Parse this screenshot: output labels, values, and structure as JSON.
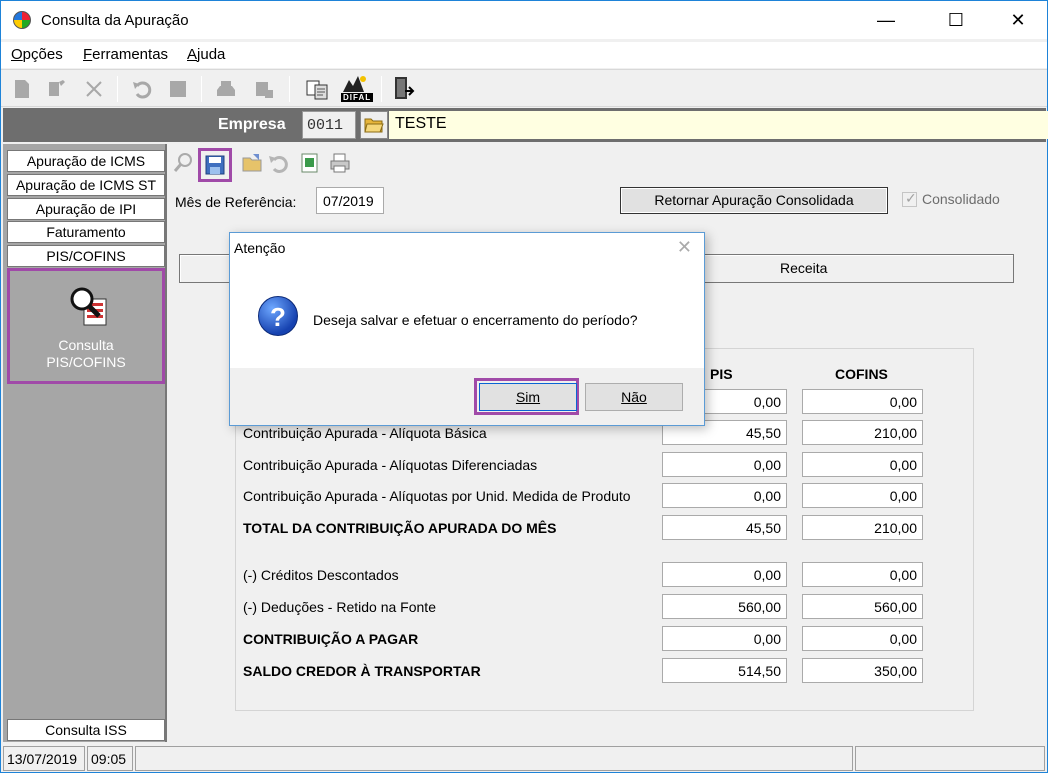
{
  "window": {
    "title": "Consulta da Apuração",
    "controls": {
      "minimize": "—",
      "maximize": "☐",
      "close": "✕"
    }
  },
  "menu": {
    "items": [
      {
        "label": "Opções",
        "underline": "O",
        "rest": "pções"
      },
      {
        "label": "Ferramentas",
        "underline": "F",
        "rest": "erramentas"
      },
      {
        "label": "Ajuda",
        "underline": "A",
        "rest": "juda"
      }
    ]
  },
  "toolbar": {
    "icons": [
      "new-icon",
      "edit-icon",
      "delete-icon",
      "undo-icon",
      "stop-icon",
      "print-icon",
      "print-preview-icon",
      "report-icon",
      "difal-icon",
      "exit-icon"
    ],
    "difal_label": "DIFAL"
  },
  "empresa": {
    "label": "Empresa",
    "code": "0011",
    "name": "TESTE"
  },
  "sidebar": {
    "tabs": [
      "Apuração de ICMS",
      "Apuração de ICMS ST",
      "Apuração de IPI",
      "Faturamento",
      "PIS/COFINS"
    ],
    "panel_label_line1": "Consulta",
    "panel_label_line2": "PIS/COFINS",
    "bottom_tab": "Consulta ISS"
  },
  "content": {
    "mes_label": "Mês de Referência:",
    "mes_value": "07/2019",
    "retornar_button": "Retornar Apuração Consolidada",
    "consolidado_label": "Consolidado",
    "consolidado_checked": true,
    "section_label": "Receita"
  },
  "table": {
    "col_pis": "PIS",
    "col_cofins": "COFINS",
    "rows": [
      {
        "label": "",
        "pis": "0,00",
        "cofins": "0,00",
        "bold": false
      },
      {
        "label": "Contribuição Apurada - Alíquota Básica",
        "pis": "45,50",
        "cofins": "210,00",
        "bold": false
      },
      {
        "label": "Contribuição Apurada - Alíquotas Diferenciadas",
        "pis": "0,00",
        "cofins": "0,00",
        "bold": false
      },
      {
        "label": "Contribuição Apurada - Alíquotas por Unid. Medida de Produto",
        "pis": "0,00",
        "cofins": "0,00",
        "bold": false
      },
      {
        "label": "TOTAL DA CONTRIBUIÇÃO APURADA DO MÊS",
        "pis": "45,50",
        "cofins": "210,00",
        "bold": true
      },
      {
        "label": "(-) Créditos Descontados",
        "pis": "0,00",
        "cofins": "0,00",
        "bold": false
      },
      {
        "label": "(-) Deduções - Retido na Fonte",
        "pis": "560,00",
        "cofins": "560,00",
        "bold": false
      },
      {
        "label": "CONTRIBUIÇÃO A PAGAR",
        "pis": "0,00",
        "cofins": "0,00",
        "bold": true
      },
      {
        "label": "SALDO CREDOR À TRANSPORTAR",
        "pis": "514,50",
        "cofins": "350,00",
        "bold": true
      }
    ]
  },
  "dialog": {
    "title": "Atenção",
    "message": "Deseja salvar e efetuar o encerramento do período?",
    "yes_button": "Sim",
    "no_button": "Não"
  },
  "status": {
    "date": "13/07/2019",
    "time": "09:05"
  },
  "colors": {
    "highlight": "#a04aa8",
    "empresa_bar": "#6e6e6e",
    "sidebar": "#a6a6a6",
    "empresa_name_bg": "#ffffe1"
  }
}
